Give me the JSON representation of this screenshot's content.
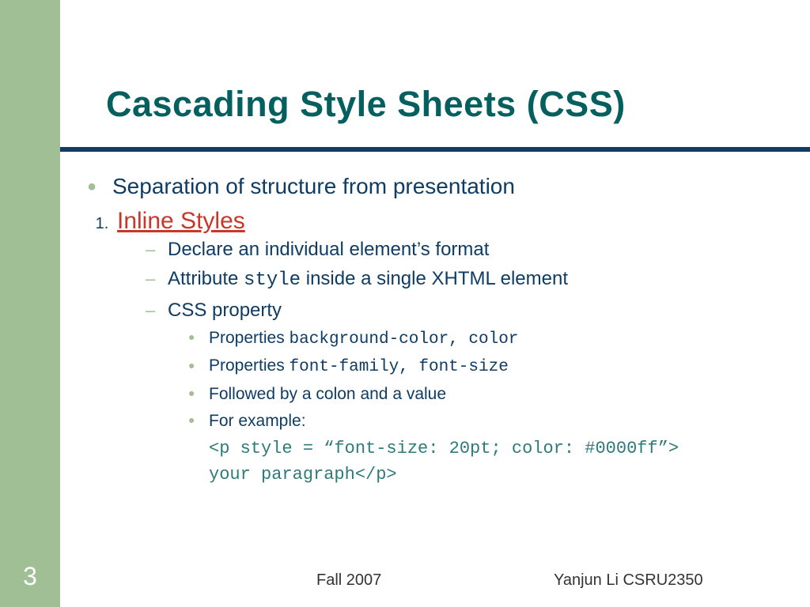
{
  "title": "Cascading Style Sheets (CSS)",
  "bullet_main": "Separation of structure from presentation",
  "numbered": {
    "index": "1.",
    "label": "Inline Styles"
  },
  "sub1": "Declare an individual element’s format",
  "sub2_pre": "Attribute ",
  "sub2_code": "style",
  "sub2_post": "  inside a single XHTML element",
  "sub3": "CSS property",
  "prop1_pre": "Properties ",
  "prop1_code": "background-color, color",
  "prop2_pre": "Properties ",
  "prop2_code": "font-family, font-size",
  "prop3": "Followed by a colon and a value",
  "prop4": "For example:",
  "code_line1": "<p style = “font-size: 20pt; color: #0000ff”>",
  "code_line2": " your paragraph</p>",
  "page_number": "3",
  "footer_center": "Fall 2007",
  "footer_right": "Yanjun Li    CSRU2350"
}
